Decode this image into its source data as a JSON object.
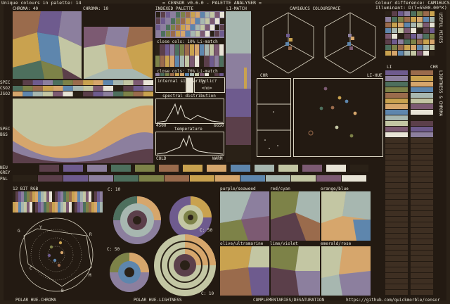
{
  "header": {
    "unique_colours": "Unique colours in palette: 14",
    "title": "= CENSOR v0.6.0 - PALETTE ANALYSER =",
    "colour_difference": "Colour difference: CAM16UCS",
    "illuminant": "Illuminant: D(T=5500.00°K)"
  },
  "labels": {
    "chroma40": "CHROMA: 40",
    "chroma10": "CHROMA: 10",
    "indexed": "INDEXED PALETTE",
    "lijmatch": "LI-MATCH",
    "cam16ucs": "CAM16UCS COLOURSPACE",
    "spec": "SPEC",
    "cso2": "CSO2",
    "jso2": "JSO2",
    "spec_bg": "SPEC",
    "bg": "BGS",
    "neu": "NEU",
    "grey": "GREY",
    "pal": "PAL",
    "bit12": "12 BIT RGB",
    "close_cols_10": "close cols: 10% Li-match",
    "close_cols_70": "close cols: 70% Li-match",
    "internal_similarity": "internal similarity",
    "cyclic": "cyclic?",
    "cyclic_val": "<no>",
    "spectral": "spectral distribution",
    "spec_lo": "4500",
    "spec_hi": "6650",
    "temperature": "temperature",
    "cold": "COLD",
    "warm": "WARM",
    "chr": "CHR",
    "li_hue": "LI-HUE",
    "li": "LI",
    "chr2": "CHR",
    "useful_mixes": "USEFUL MIXES",
    "lightness_chroma": "LIGHTNESS & CHROMA",
    "c10": "C: 10",
    "c50a": "C: 50",
    "c50b": "C: 50",
    "c10b": "C: 10",
    "purple_seaweed": "purple/seaweed",
    "red_cyan": "red/cyan",
    "orange_blue": "orange/blue",
    "olive_ultramarine": "olive/ultramarine",
    "lime_violet": "lime/violet",
    "emerald_rose": "emerald/rose",
    "polar_hue_chroma": "POLAR HUE-CHROMA",
    "polar_hue_lightness": "POLAR HUE-LIGHTNESS",
    "complementaries": "COMPLEMENTARIES/DESATURATION",
    "github": "https://github.com/quickmorble/censor",
    "axis_g": "G",
    "axis_y": "Y",
    "axis_r": "R",
    "axis_m": "M",
    "axis_b": "B",
    "axis_c": "C"
  },
  "palette": [
    "#2a2117",
    "#5b3f4a",
    "#6e5b8e",
    "#8c7f9e",
    "#4d6f5d",
    "#7d8248",
    "#9a6b4c",
    "#c9a24f",
    "#d6a66c",
    "#5e86ad",
    "#a7b7b0",
    "#c3c6a3",
    "#7c5a72",
    "#e8e4d6"
  ],
  "colors": {
    "background": "#2a2117",
    "panel": "#231a12",
    "text": "#e8e4d6"
  }
}
